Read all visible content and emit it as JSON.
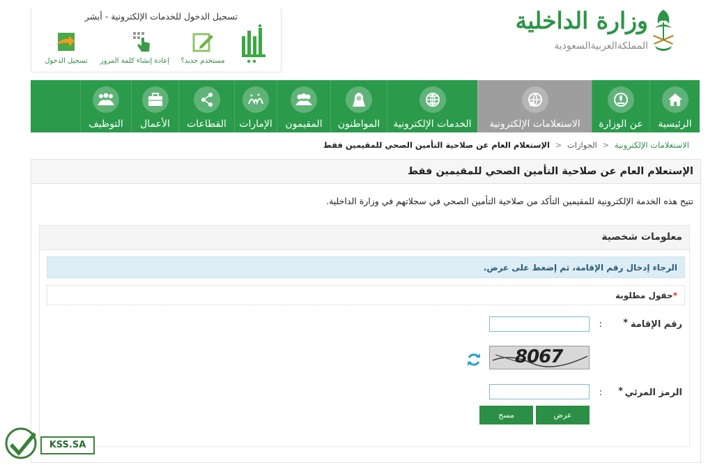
{
  "header": {
    "absher": {
      "title": "تسجيل الدخول للخدمات الإلكترونية - أبشر",
      "logo_text": "أبشر",
      "links": [
        {
          "label": "مستخدم جديد؟",
          "icon": "new-user-icon"
        },
        {
          "label": "إعادة إنشاء كلمة المرور",
          "icon": "reset-password-icon"
        },
        {
          "label": "تسجيل الدخول",
          "icon": "login-icon"
        }
      ]
    },
    "ministry": {
      "name": "وزارة الداخلية",
      "country": "المملكةالعربيةالسعودية",
      "emblem": "saudi-emblem-icon"
    }
  },
  "nav": {
    "items": [
      {
        "label": "الرئيسية",
        "icon": "home-icon",
        "active": false
      },
      {
        "label": "عن الوزارة",
        "icon": "ministry-icon",
        "active": false
      },
      {
        "label": "الاستعلامات الإلكترونية",
        "icon": "globe-search-icon",
        "active": true
      },
      {
        "label": "الخدمات الإلكترونية",
        "icon": "globe-icon",
        "active": false
      },
      {
        "label": "المواطنون",
        "icon": "citizen-icon",
        "active": false
      },
      {
        "label": "المقيمون",
        "icon": "residents-icon",
        "active": false
      },
      {
        "label": "الإمارات",
        "icon": "emirates-icon",
        "active": false
      },
      {
        "label": "القطاعات",
        "icon": "sectors-icon",
        "active": false
      },
      {
        "label": "الأعمال",
        "icon": "briefcase-icon",
        "active": false
      },
      {
        "label": "التوظيف",
        "icon": "employment-icon",
        "active": false
      }
    ],
    "accent": "#2b9a4b",
    "active_color": "#9e9e9e"
  },
  "breadcrumb": {
    "items": [
      "الاستعلامات الإلكترونية",
      "الجوازات"
    ],
    "current": "الإستعلام العام عن صلاحية التأمين الصحي للمقيمين فقط"
  },
  "page": {
    "title": "الإستعلام العام عن صلاحية التأمين الصحي للمقيمين فقط",
    "intro": "تتيح هذه الخدمة الإلكترونية للمقيمين التأكد من صلاحية التأمين الصحي في سجلاتهم في وزارة الداخلية."
  },
  "form": {
    "section_title": "معلومات شخصية",
    "alert": "الرجاء إدخال رقم الإقامة، ثم إضغط على عرض.",
    "required_note": "حقول مطلوبة",
    "fields": {
      "iqama_label": "رقم الإقامة",
      "iqama_value": "",
      "captcha_label": "الرمز المرئي",
      "captcha_value": "",
      "captcha_image_text": "8067",
      "colon": ":",
      "required_mark": "*"
    },
    "buttons": {
      "submit": "عرض",
      "clear": "مسح"
    }
  },
  "watermark": {
    "text": "KSS.SA",
    "icon": "checkmark-icon"
  }
}
